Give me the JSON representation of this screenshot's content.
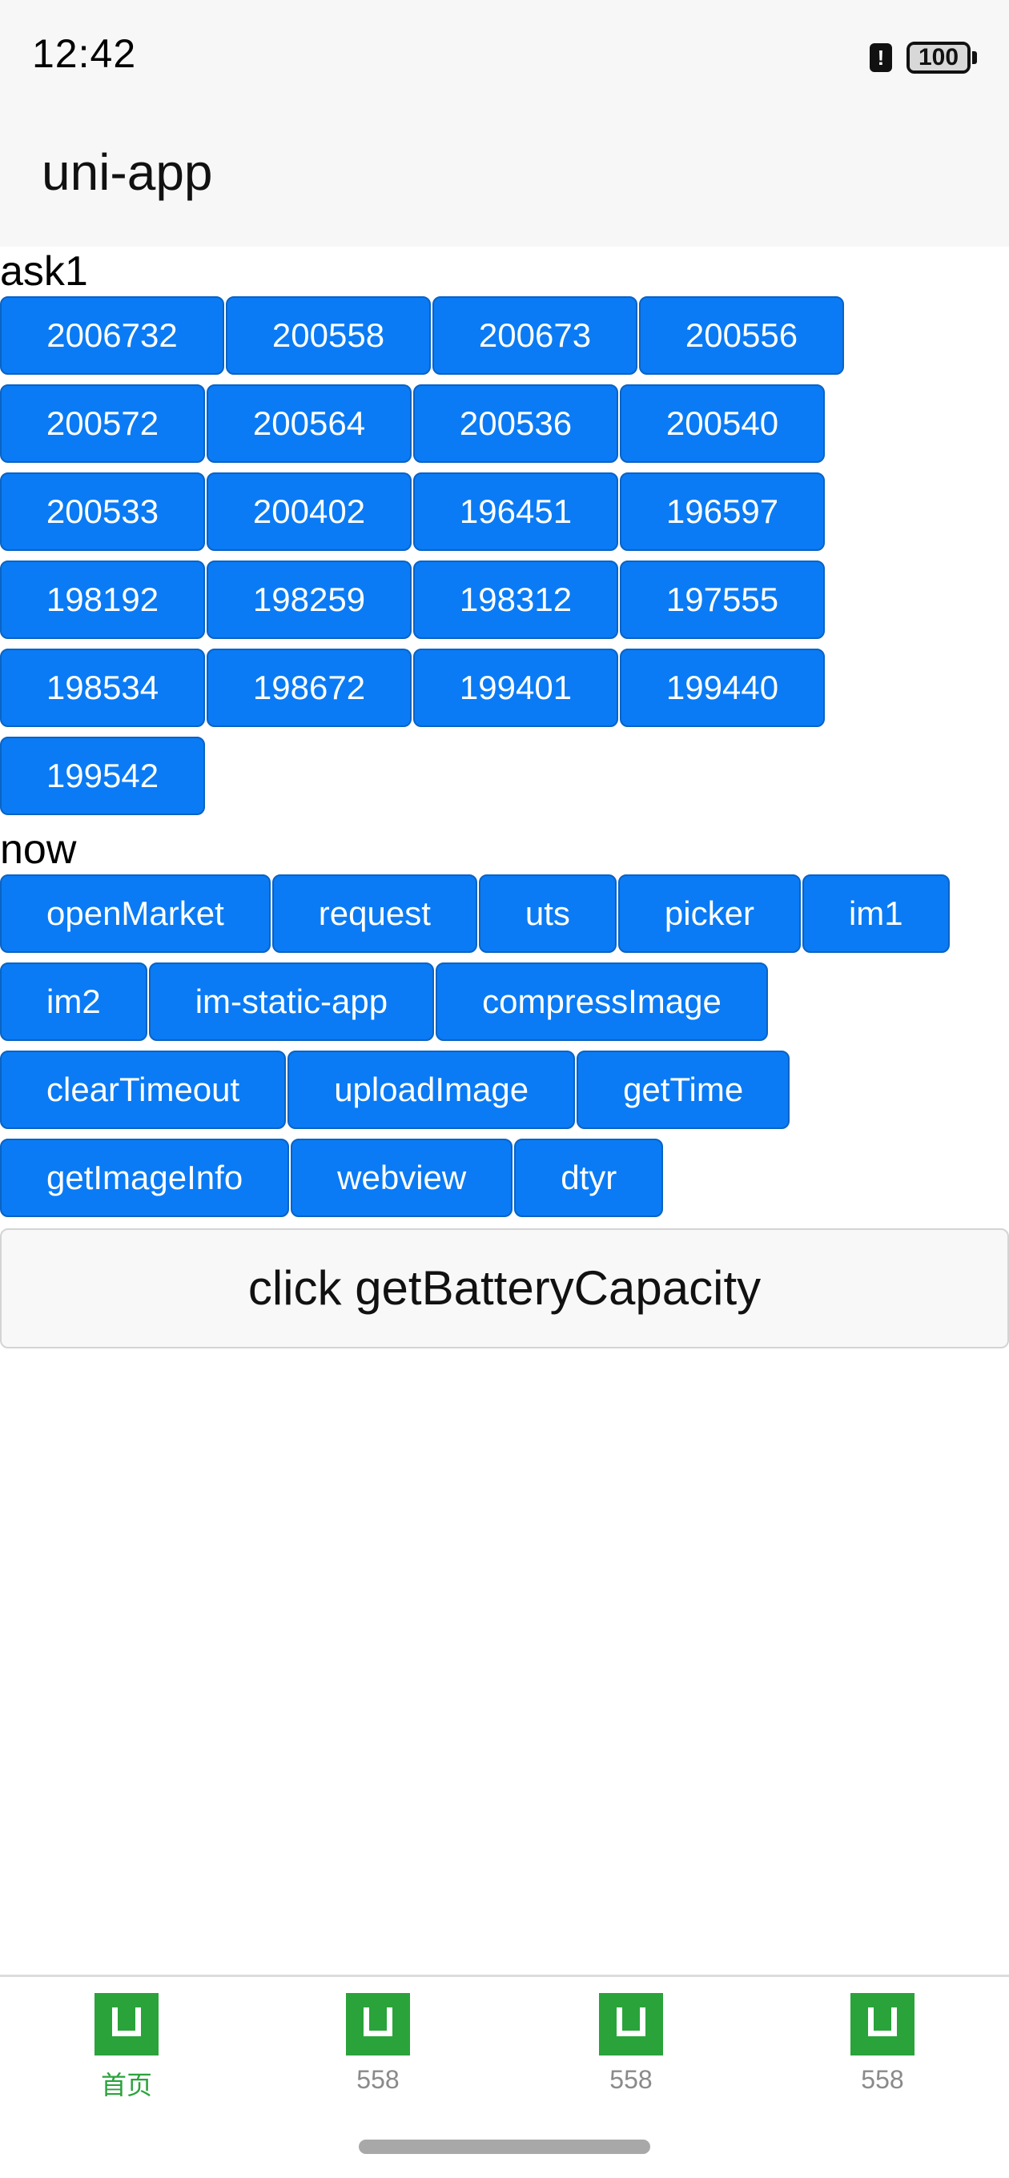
{
  "status": {
    "time": "12:42",
    "battery": "100",
    "alert": "!"
  },
  "nav": {
    "title": "uni-app"
  },
  "ask1": {
    "label": "ask1",
    "buttons": [
      "2006732",
      "200558",
      "200673",
      "200556",
      "200572",
      "200564",
      "200536",
      "200540",
      "200533",
      "200402",
      "196451",
      "196597",
      "198192",
      "198259",
      "198312",
      "197555",
      "198534",
      "198672",
      "199401",
      "199440",
      "199542"
    ]
  },
  "now": {
    "label": "now",
    "buttons": [
      "openMarket",
      "request",
      "uts",
      "picker",
      "im1",
      "im2",
      "im-static-app",
      "compressImage",
      "clearTimeout",
      "uploadImage",
      "getTime",
      "getImageInfo",
      "webview",
      "dtyr"
    ]
  },
  "battery_button": "click getBatteryCapacity",
  "tabs": [
    {
      "label": "首页",
      "icon": "uniapp-logo-icon",
      "active": true
    },
    {
      "label": "558",
      "icon": "uniapp-logo-icon",
      "active": false
    },
    {
      "label": "558",
      "icon": "uniapp-logo-icon",
      "active": false
    },
    {
      "label": "558",
      "icon": "uniapp-logo-icon",
      "active": false
    }
  ],
  "colors": {
    "button": "#0a7bf5",
    "tab_active": "#2aa33b",
    "tab_inactive": "#8a8a8a"
  }
}
